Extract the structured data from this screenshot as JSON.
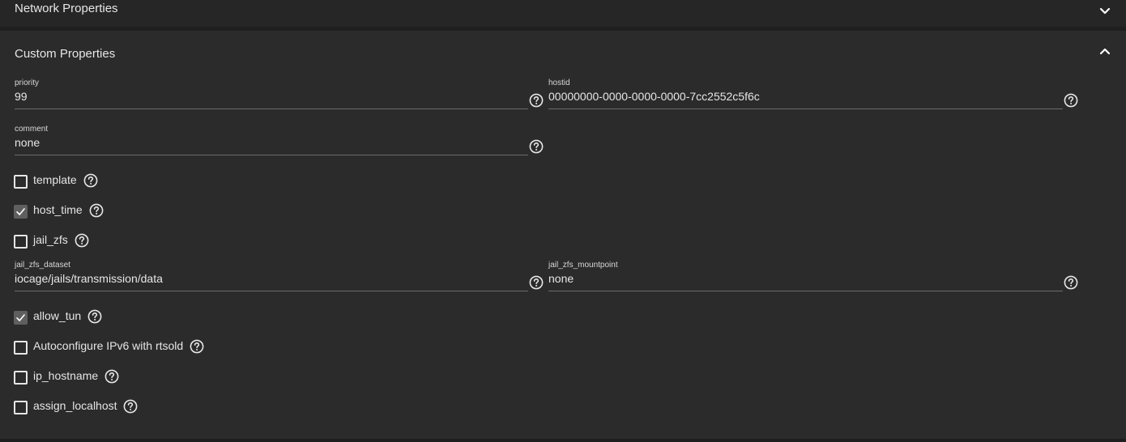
{
  "network_section": {
    "title": "Network Properties",
    "expanded": false
  },
  "custom_section": {
    "title": "Custom Properties",
    "expanded": true,
    "fields": {
      "priority": {
        "label": "priority",
        "value": "99"
      },
      "hostid": {
        "label": "hostid",
        "value": "00000000-0000-0000-0000-7cc2552c5f6c"
      },
      "comment": {
        "label": "comment",
        "value": "none"
      },
      "jail_zfs_dataset": {
        "label": "jail_zfs_dataset",
        "value": "iocage/jails/transmission/data"
      },
      "jail_zfs_mountpoint": {
        "label": "jail_zfs_mountpoint",
        "value": "none"
      }
    },
    "checkboxes": {
      "template": {
        "label": "template",
        "checked": false
      },
      "host_time": {
        "label": "host_time",
        "checked": true
      },
      "jail_zfs": {
        "label": "jail_zfs",
        "checked": false
      },
      "allow_tun": {
        "label": "allow_tun",
        "checked": true
      },
      "autoconfigure_ipv6": {
        "label": "Autoconfigure IPv6 with rtsold",
        "checked": false
      },
      "ip_hostname": {
        "label": "ip_hostname",
        "checked": false
      },
      "assign_localhost": {
        "label": "assign_localhost",
        "checked": false
      }
    }
  },
  "colors": {
    "background": "#1f1f1f",
    "section_bg": "#2b2b2b",
    "text": "#e6e6e6",
    "underline": "#6b6b6b",
    "checked_box": "#5f5f5f"
  },
  "icons": {
    "collapse": "chevron-up-icon",
    "expand": "chevron-down-icon",
    "help": "help-circle-icon",
    "check": "checkmark-icon"
  }
}
